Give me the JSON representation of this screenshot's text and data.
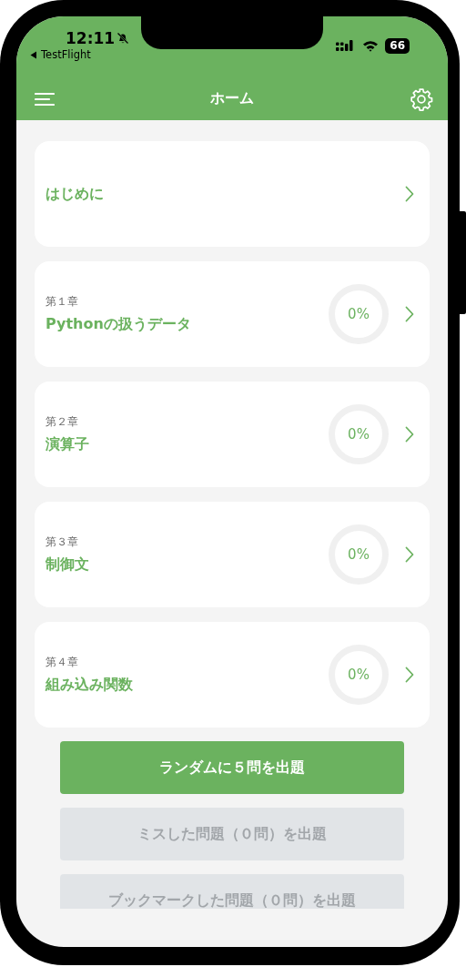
{
  "status_bar": {
    "time": "12:11",
    "back_app": "TestFlight",
    "battery": "66"
  },
  "nav_bar": {
    "title": "ホーム"
  },
  "sections": [
    {
      "kind": "intro",
      "title": "はじめに"
    },
    {
      "kind": "chapter",
      "label": "第１章",
      "title": "Pythonの扱うデータ",
      "progress": "0%",
      "level": 0
    },
    {
      "kind": "chapter",
      "label": "第２章",
      "title": "演算子",
      "progress": "0%",
      "level": 0
    },
    {
      "kind": "chapter",
      "label": "第３章",
      "title": "制御文",
      "progress": "0%",
      "level": 0
    },
    {
      "kind": "chapter",
      "label": "第４章",
      "title": "組み込み関数",
      "progress": "0%",
      "level": 0
    }
  ],
  "buttons": [
    {
      "label": "ランダムに５問を出題",
      "disabled": false
    },
    {
      "label": "ミスした問題（０問）を出題",
      "disabled": true
    },
    {
      "label": "ブックマークした問題（０問）を出題",
      "disabled": true
    }
  ]
}
